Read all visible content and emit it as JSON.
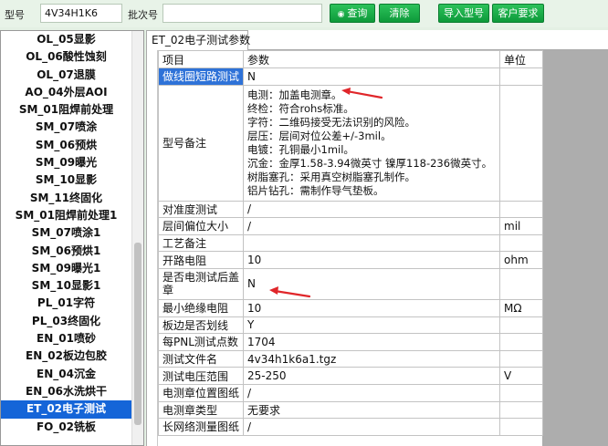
{
  "toolbar": {
    "model_label": "型号",
    "model_value": "4V34H1K6",
    "batch_label": "批次号",
    "batch_value": "",
    "query_label": "查询",
    "clear_label": "清除",
    "import_label": "导入型号",
    "customer_label": "客户要求",
    "accent": "#16a847"
  },
  "process_list": {
    "items": [
      "OL_05显影",
      "OL_06酸性蚀刻",
      "OL_07退膜",
      "AO_04外层AOI",
      "SM_01阻焊前处理",
      "SM_07喷涂",
      "SM_06预烘",
      "SM_09曝光",
      "SM_10显影",
      "SM_11终固化",
      "SM_01阻焊前处理1",
      "SM_07喷涂1",
      "SM_06预烘1",
      "SM_09曝光1",
      "SM_10显影1",
      "PL_01字符",
      "PL_03终固化",
      "EN_01喷砂",
      "EN_02板边包胶",
      "EN_04沉金",
      "EN_06水洗烘干",
      "ET_02电子测试",
      "FO_02铣板"
    ],
    "selected": "ET_02电子测试",
    "selected_color": "#1565d8"
  },
  "tab": {
    "label": "ET_02电子测试参数"
  },
  "table": {
    "headers": [
      "项目",
      "参数",
      "单位"
    ],
    "rows": [
      {
        "item": "做线圈短路测试",
        "param": "N",
        "unit": "",
        "highlight": true
      },
      {
        "item": "型号备注",
        "param_lines": [
          "电测：加盖电测章。",
          "终检：符合rohs标准。",
          "字符：二维码接受无法识别的风险。",
          "层压：层间对位公差+/-3mil。",
          "电镀：孔铜最小1mil。",
          "沉金：金厚1.58-3.94微英寸 镍厚118-236微英寸。",
          "树脂塞孔：采用真空树脂塞孔制作。",
          "铝片钻孔：需制作导气垫板。"
        ],
        "unit": ""
      },
      {
        "item": "对准度测试",
        "param": "/",
        "unit": ""
      },
      {
        "item": "层间偏位大小",
        "param": "/",
        "unit": "mil"
      },
      {
        "item": "工艺备注",
        "param": "",
        "unit": ""
      },
      {
        "item": "开路电阻",
        "param": "10",
        "unit": "ohm"
      },
      {
        "item": "是否电测试后盖章",
        "param": "N",
        "unit": "",
        "wrap": true
      },
      {
        "item": "最小绝缘电阻",
        "param": "10",
        "unit": "MΩ"
      },
      {
        "item": "板边是否划线",
        "param": "Y",
        "unit": ""
      },
      {
        "item": "每PNL测试点数",
        "param": "1704",
        "unit": ""
      },
      {
        "item": "测试文件名",
        "param": "4v34h1k6a1.tgz",
        "unit": ""
      },
      {
        "item": "测试电压范围",
        "param": "25-250",
        "unit": "V"
      },
      {
        "item": "电测章位置图纸",
        "param": "/",
        "unit": ""
      },
      {
        "item": "电测章类型",
        "param": "无要求",
        "unit": ""
      },
      {
        "item": "长网络测量图纸",
        "param": "/",
        "unit": ""
      }
    ],
    "highlight_color": "#2e72d8"
  },
  "annotations": {
    "arrow_color": "#e0262a"
  }
}
